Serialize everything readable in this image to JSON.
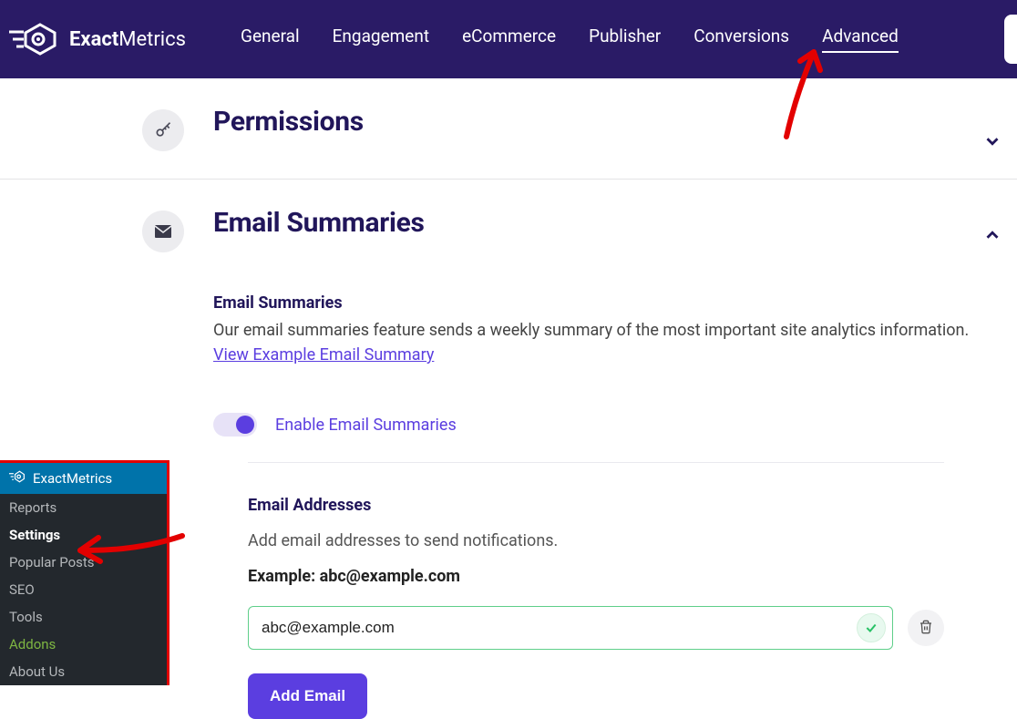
{
  "brand": {
    "name_bold": "Exact",
    "name_light": "Metrics"
  },
  "nav": {
    "items": [
      "General",
      "Engagement",
      "eCommerce",
      "Publisher",
      "Conversions",
      "Advanced"
    ],
    "active_index": 5
  },
  "sections": {
    "permissions": {
      "title": "Permissions"
    },
    "email": {
      "title": "Email Summaries",
      "subheading": "Email Summaries",
      "desc_pre": "Our email summaries feature sends a weekly summary of the most important site analytics information. ",
      "desc_link": "View Example Email Summary",
      "toggle_label": "Enable Email Summaries",
      "field_label": "Email Addresses",
      "field_help": "Add email addresses to send notifications.",
      "field_example": "Example: abc@example.com",
      "input_value": "abc@example.com",
      "add_button": "Add Email"
    }
  },
  "wp_sidebar": {
    "active": "ExactMetrics",
    "items": [
      {
        "label": "Reports",
        "style": "normal"
      },
      {
        "label": "Settings",
        "style": "bold"
      },
      {
        "label": "Popular Posts",
        "style": "normal"
      },
      {
        "label": "SEO",
        "style": "normal"
      },
      {
        "label": "Tools",
        "style": "normal"
      },
      {
        "label": "Addons",
        "style": "green"
      },
      {
        "label": "About Us",
        "style": "normal"
      }
    ]
  }
}
